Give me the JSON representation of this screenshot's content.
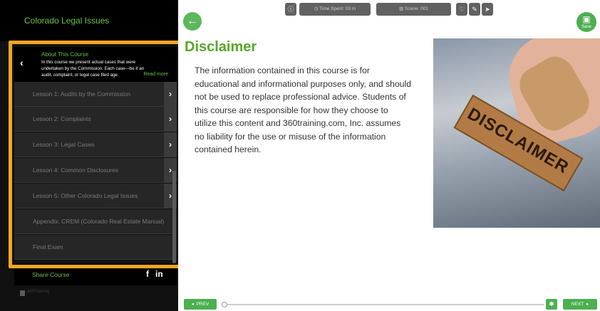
{
  "sidebar": {
    "course_title": "Colorado Legal Issues",
    "about": {
      "title": "About This Course",
      "text": "In this course we present actual cases that were undertaken by the Commission. Each case—be it an audit, complaint, or legal case filed age",
      "read_more": "Read more"
    },
    "lessons": [
      {
        "label": "Lesson 1: Audits by the Commission",
        "has_chevron": true
      },
      {
        "label": "Lesson 2: Complaints",
        "has_chevron": true
      },
      {
        "label": "Lesson 3: Legal Cases",
        "has_chevron": true
      },
      {
        "label": "Lesson 4: Common Disclosures",
        "has_chevron": true
      },
      {
        "label": "Lesson 5: Other Colorado Legal Issues",
        "has_chevron": true
      },
      {
        "label": "Appendix: CREM (Colorado Real Estate Manual)",
        "has_chevron": false
      },
      {
        "label": "Final Exam",
        "has_chevron": false
      }
    ],
    "share": {
      "label": "Share Course",
      "facebook": "f",
      "linkedin": "in"
    },
    "logo_alt": "360Training"
  },
  "topbar": {
    "time_spent": "Time Spent: 03 m",
    "scene": "Scene: 001"
  },
  "save_label": "Save",
  "content": {
    "heading": "Disclaimer",
    "body": "The information contained in this course is for educational and informational purposes only, and should not be used to replace professional advice. Students of this course are responsible for how they choose to utilize this content and 360training.com, Inc. assumes no liability for the use or misuse of the information contained herein.",
    "image_text": "DISCLAIMER"
  },
  "footer": {
    "prev_label": "PREV",
    "next_label": "NEXT",
    "progress_fraction": 0.0
  },
  "colors": {
    "accent_green": "#4caf50",
    "heading_green": "#58a628",
    "highlight_orange": "#f5a623",
    "sidebar_bg": "#111111"
  }
}
